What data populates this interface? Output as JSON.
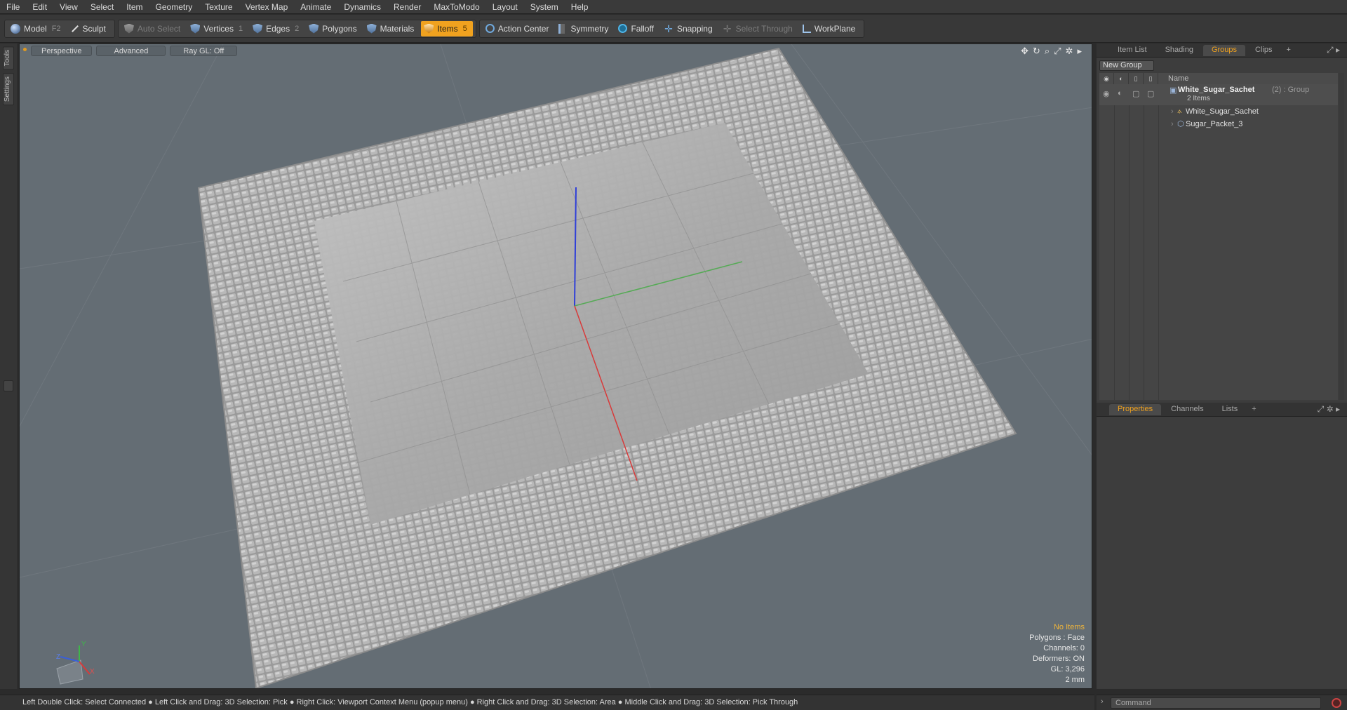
{
  "menus": [
    "File",
    "Edit",
    "View",
    "Select",
    "Item",
    "Geometry",
    "Texture",
    "Vertex Map",
    "Animate",
    "Dynamics",
    "Render",
    "MaxToModo",
    "Layout",
    "System",
    "Help"
  ],
  "toolbar": {
    "model": "Model",
    "model_key": "F2",
    "sculpt": "Sculpt",
    "auto_select": "Auto Select",
    "vertices": "Vertices",
    "vertices_key": "1",
    "edges": "Edges",
    "edges_key": "2",
    "polygons": "Polygons",
    "materials": "Materials",
    "items": "Items",
    "items_key": "5",
    "action_center": "Action Center",
    "symmetry": "Symmetry",
    "falloff": "Falloff",
    "snapping": "Snapping",
    "select_through": "Select Through",
    "workplane": "WorkPlane"
  },
  "left_tabs": [
    "Tools",
    "Settings"
  ],
  "viewport": {
    "view_mode": "Perspective",
    "shading": "Advanced",
    "ray_gl": "Ray GL: Off",
    "info": {
      "selection": "No Items",
      "polygons": "Polygons : Face",
      "channels": "Channels: 0",
      "deformers": "Deformers: ON",
      "gl": "GL: 3,296",
      "scale": "2 mm"
    },
    "axis_labels": {
      "x": "X",
      "y": "Y",
      "z": "Z"
    }
  },
  "top_tabs": [
    {
      "label": "Item List",
      "active": false
    },
    {
      "label": "Shading",
      "active": false
    },
    {
      "label": "Groups",
      "active": true
    },
    {
      "label": "Clips",
      "active": false
    }
  ],
  "groups": {
    "new_group": "New Group",
    "name_header": "Name",
    "group_name": "White_Sugar_Sachet",
    "group_meta": "(2) : Group",
    "group_count": "2 Items",
    "children": [
      "White_Sugar_Sachet",
      "Sugar_Packet_3"
    ]
  },
  "bottom_tabs": [
    {
      "label": "Properties",
      "active": true
    },
    {
      "label": "Channels",
      "active": false
    },
    {
      "label": "Lists",
      "active": false
    }
  ],
  "status": "Left Double Click: Select Connected ● Left Click and Drag: 3D Selection: Pick ● Right Click: Viewport Context Menu (popup menu) ● Right Click and Drag: 3D Selection: Area ● Middle Click and Drag: 3D Selection: Pick Through",
  "command_placeholder": "Command",
  "colors": {
    "accent": "#f0a21f",
    "viewport_bg": "#646d74"
  }
}
